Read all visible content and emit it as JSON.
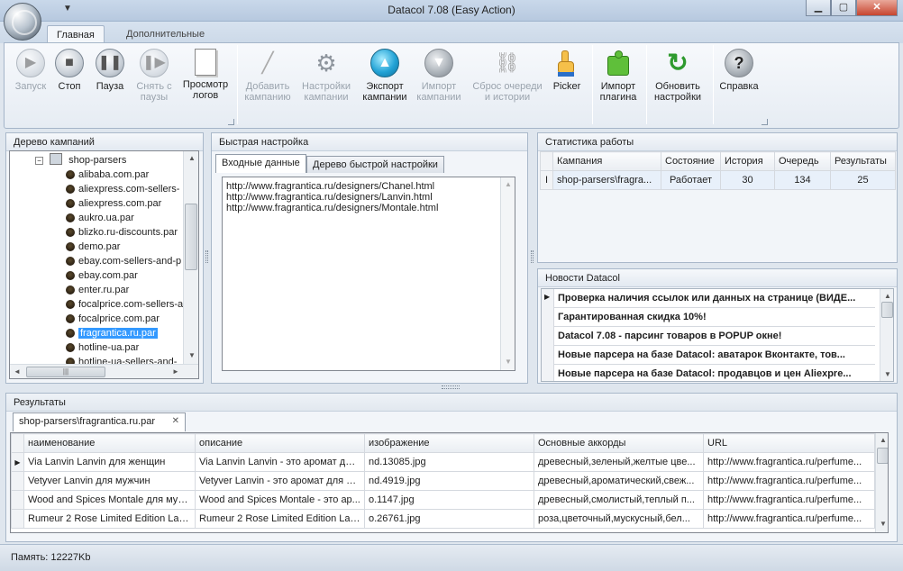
{
  "window": {
    "title": "Datacol 7.08 (Easy Action)",
    "minimize": "▁",
    "maximize": "▢",
    "close": "✕",
    "quick_access": "▼"
  },
  "ribbon": {
    "tabs": [
      {
        "label": "Главная"
      },
      {
        "label": "Дополнительные"
      }
    ],
    "buttons": {
      "start": {
        "line1": "Запуск",
        "line2": "",
        "icon": "play-icon"
      },
      "stop": {
        "line1": "Стоп",
        "line2": "",
        "icon": "stop-icon"
      },
      "pause": {
        "line1": "Пауза",
        "line2": "",
        "icon": "pause-icon"
      },
      "unpause": {
        "line1": "Снять с",
        "line2": "паузы",
        "icon": "unpause-icon"
      },
      "logs": {
        "line1": "Просмотр",
        "line2": "логов",
        "icon": "log-icon"
      },
      "add_campaign": {
        "line1": "Добавить",
        "line2": "кампанию",
        "icon": "magic-wand-icon"
      },
      "campaign_settings": {
        "line1": "Настройки",
        "line2": "кампании",
        "icon": "gear-icon"
      },
      "export": {
        "line1": "Экспорт",
        "line2": "кампании",
        "icon": "up-arrow-icon"
      },
      "import": {
        "line1": "Импорт",
        "line2": "кампании",
        "icon": "down-arrow-icon"
      },
      "reset": {
        "line1": "Сброс очереди",
        "line2": "и истории",
        "icon": "reset-icon"
      },
      "picker": {
        "line1": "Picker",
        "line2": "",
        "icon": "pointer-hand-icon"
      },
      "import_plugin": {
        "line1": "Импорт",
        "line2": "плагина",
        "icon": "puzzle-icon"
      },
      "update_settings": {
        "line1": "Обновить",
        "line2": "настройки",
        "icon": "refresh-icon"
      },
      "help": {
        "line1": "Справка",
        "line2": "",
        "icon": "help-icon",
        "glyph": "?"
      }
    }
  },
  "tree_panel": {
    "header": "Дерево кампаний",
    "root": "shop-parsers",
    "items": [
      "alibaba.com.par",
      "aliexpress.com-sellers-",
      "aliexpress.com.par",
      "aukro.ua.par",
      "blizko.ru-discounts.par",
      "demo.par",
      "ebay.com-sellers-and-p",
      "ebay.com.par",
      "enter.ru.par",
      "focalprice.com-sellers-a",
      "focalprice.com.par",
      "fragrantica.ru.par",
      "hotline-ua.par",
      "hotline-ua-sellers-and-"
    ],
    "scroll_left": "◄",
    "scroll_right": "►",
    "scroll_up": "▲",
    "scroll_down": "▼",
    "grip": "|||"
  },
  "quick_panel": {
    "header": "Быстрая настройка",
    "tabs": [
      {
        "label": "Входные данные"
      },
      {
        "label": "Дерево быстрой настройки"
      }
    ],
    "urls": [
      "http://www.fragrantica.ru/designers/Chanel.html",
      "http://www.fragrantica.ru/designers/Lanvin.html",
      "http://www.fragrantica.ru/designers/Montale.html"
    ]
  },
  "stats_panel": {
    "header": "Статистика работы",
    "columns": [
      "Кампания",
      "Состояние",
      "История",
      "Очередь",
      "Результаты"
    ],
    "rows": [
      {
        "marker": "I",
        "campaign": "shop-parsers\\fragra...",
        "state": "Работает",
        "history": "30",
        "queue": "134",
        "results": "25"
      }
    ]
  },
  "news_panel": {
    "header": "Новости Datacol",
    "items": [
      "Проверка наличия ссылок или данных на странице (ВИДЕ...",
      "Гарантированная скидка 10%!",
      "Datacol 7.08 - парсинг товаров в POPUP окне!",
      "Новые парсера на базе Datacol: аватарок Вконтакте, тов...",
      "Новые парсера на базе Datacol: продавцов и цен Aliexpre..."
    ],
    "current_marker": "▶"
  },
  "results_panel": {
    "header": "Результаты",
    "tab": "shop-parsers\\fragrantica.ru.par",
    "tab_close": "✕",
    "columns": [
      "наименование",
      "описание",
      "изображение",
      "Основные аккорды",
      "URL"
    ],
    "rows": [
      {
        "name": "Via Lanvin Lanvin для женщин",
        "desc": "Via Lanvin Lanvin - это аромат для...",
        "img": "nd.13085.jpg",
        "accords": "древесный,зеленый,желтые цве...",
        "url": "http://www.fragrantica.ru/perfume..."
      },
      {
        "name": "Vetyver Lanvin для мужчин",
        "desc": "Vetyver Lanvin - это аромат для м...",
        "img": "nd.4919.jpg",
        "accords": "древесный,ароматический,свеж...",
        "url": "http://www.fragrantica.ru/perfume..."
      },
      {
        "name": "Wood and Spices Montale для муж...",
        "desc": "Wood and Spices Montale - это ар...",
        "img": "o.1147.jpg",
        "accords": "древесный,смолистый,теплый п...",
        "url": "http://www.fragrantica.ru/perfume..."
      },
      {
        "name": "Rumeur 2 Rose Limited Edition Lanv...",
        "desc": "Rumeur 2 Rose Limited Edition Lanv...",
        "img": "o.26761.jpg",
        "accords": "роза,цветочный,мускусный,бел...",
        "url": "http://www.fragrantica.ru/perfume..."
      }
    ],
    "current_marker": "▶"
  },
  "status": {
    "memory": "Память: 12227Kb"
  }
}
